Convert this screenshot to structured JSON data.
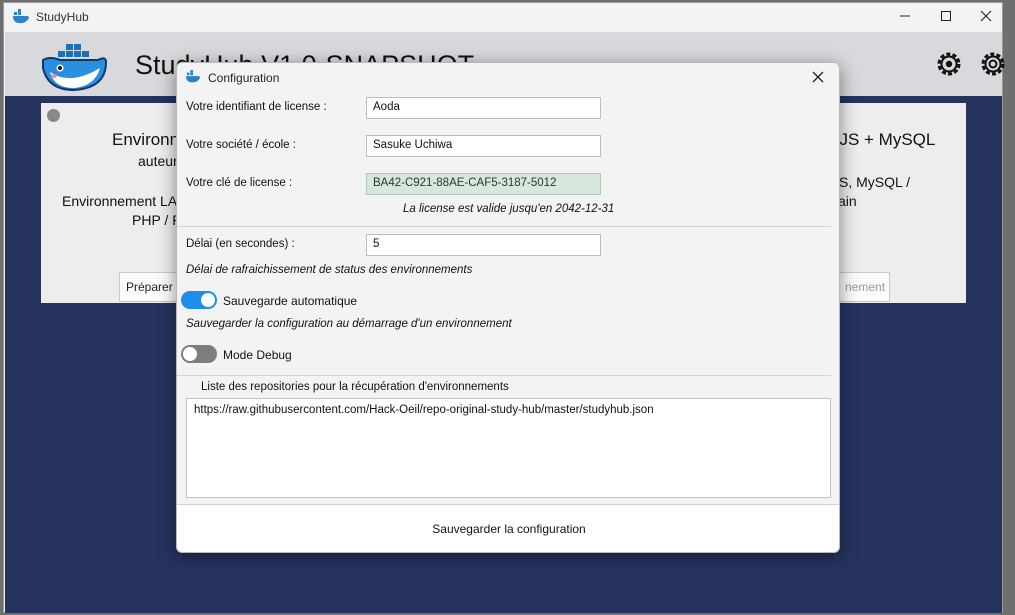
{
  "window": {
    "title": "StudyHub",
    "icon": "docker-whale-icon"
  },
  "header": {
    "app_title": "StudyHub V1.0-SNAPSHOT"
  },
  "cards": {
    "left": {
      "title": "Environn",
      "subtitle": "auteur",
      "description": "Environnement LA",
      "description2": "PHP / P",
      "button": "Préparer l"
    },
    "right": {
      "title": "eJS + MySQL",
      "description": "JS, MySQL /",
      "description2": "ain",
      "button": "nement"
    }
  },
  "dialog": {
    "title": "Configuration",
    "license_id_label": "Votre identifiant de license :",
    "license_id_value": "Aoda",
    "company_label": "Votre société / école :",
    "company_value": "Sasuke Uchiwa",
    "license_key_label": "Votre clé de license :",
    "license_key_value": "BA42-C921-88AE-CAF5-3187-5012",
    "license_validity": "La license est valide jusqu'en 2042-12-31",
    "delay_label": "Délai (en secondes) :",
    "delay_value": "5",
    "delay_hint": "Délai de rafraichissement de status des environnements",
    "autosave_label": "Sauvegarde automatique",
    "autosave_on": true,
    "autosave_hint": "Sauvegarder la configuration au démarrage d'un environnement",
    "debug_label": "Mode Debug",
    "debug_on": false,
    "repos_label": "Liste des repositories pour la récupération d'environnements",
    "repos_value": "https://raw.githubusercontent.com/Hack-Oeil/repo-original-study-hub/master/studyhub.json",
    "save_button": "Sauvegarder la configuration"
  },
  "colors": {
    "accent": "#1d8fe8",
    "background": "#27335f",
    "valid_field": "#d6e8dc"
  }
}
